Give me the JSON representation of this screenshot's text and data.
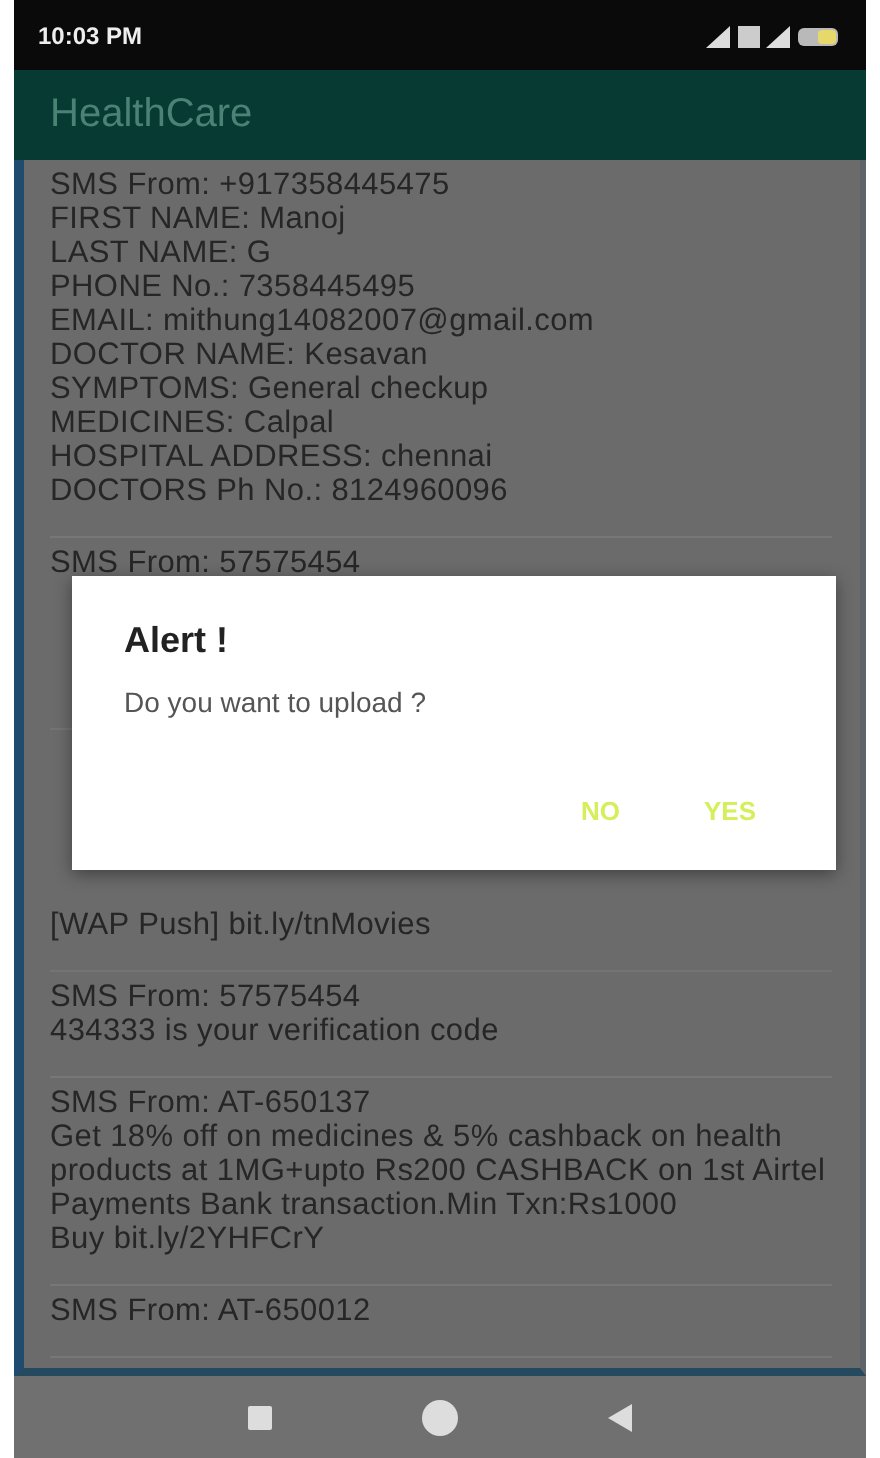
{
  "status_bar": {
    "time": "10:03 PM"
  },
  "app_bar": {
    "title": "HealthCare"
  },
  "messages": [
    {
      "kind": "full",
      "lines": [
        "SMS From: +917358445475",
        "FIRST NAME: Manoj",
        "LAST NAME: G",
        "PHONE No.: 7358445495",
        "EMAIL: mithung14082007@gmail.com",
        "DOCTOR NAME: Kesavan",
        "SYMPTOMS: General checkup",
        "MEDICINES: Calpal",
        "HOSPITAL ADDRESS: chennai",
        "DOCTORS Ph No.: 8124960096"
      ]
    },
    {
      "kind": "covered",
      "lines": [
        "SMS From: 57575454"
      ]
    },
    {
      "kind": "covered",
      "lines": [
        "[WAP Push] bit.ly/tnMovies"
      ]
    },
    {
      "kind": "full",
      "lines": [
        "SMS From: 57575454",
        "434333 is your verification code"
      ]
    },
    {
      "kind": "full",
      "lines": [
        "SMS From: AT-650137",
        "Get 18% off on medicines & 5% cashback on health products at 1MG+upto Rs200 CASHBACK on 1st Airtel Payments Bank transaction.Min Txn:Rs1000",
        "Buy bit.ly/2YHFCrY"
      ]
    },
    {
      "kind": "full",
      "lines": [
        "SMS From: AT-650012"
      ]
    }
  ],
  "dialog": {
    "title": "Alert !",
    "message": "Do you want to upload ?",
    "buttons": [
      "NO",
      "YES"
    ]
  }
}
